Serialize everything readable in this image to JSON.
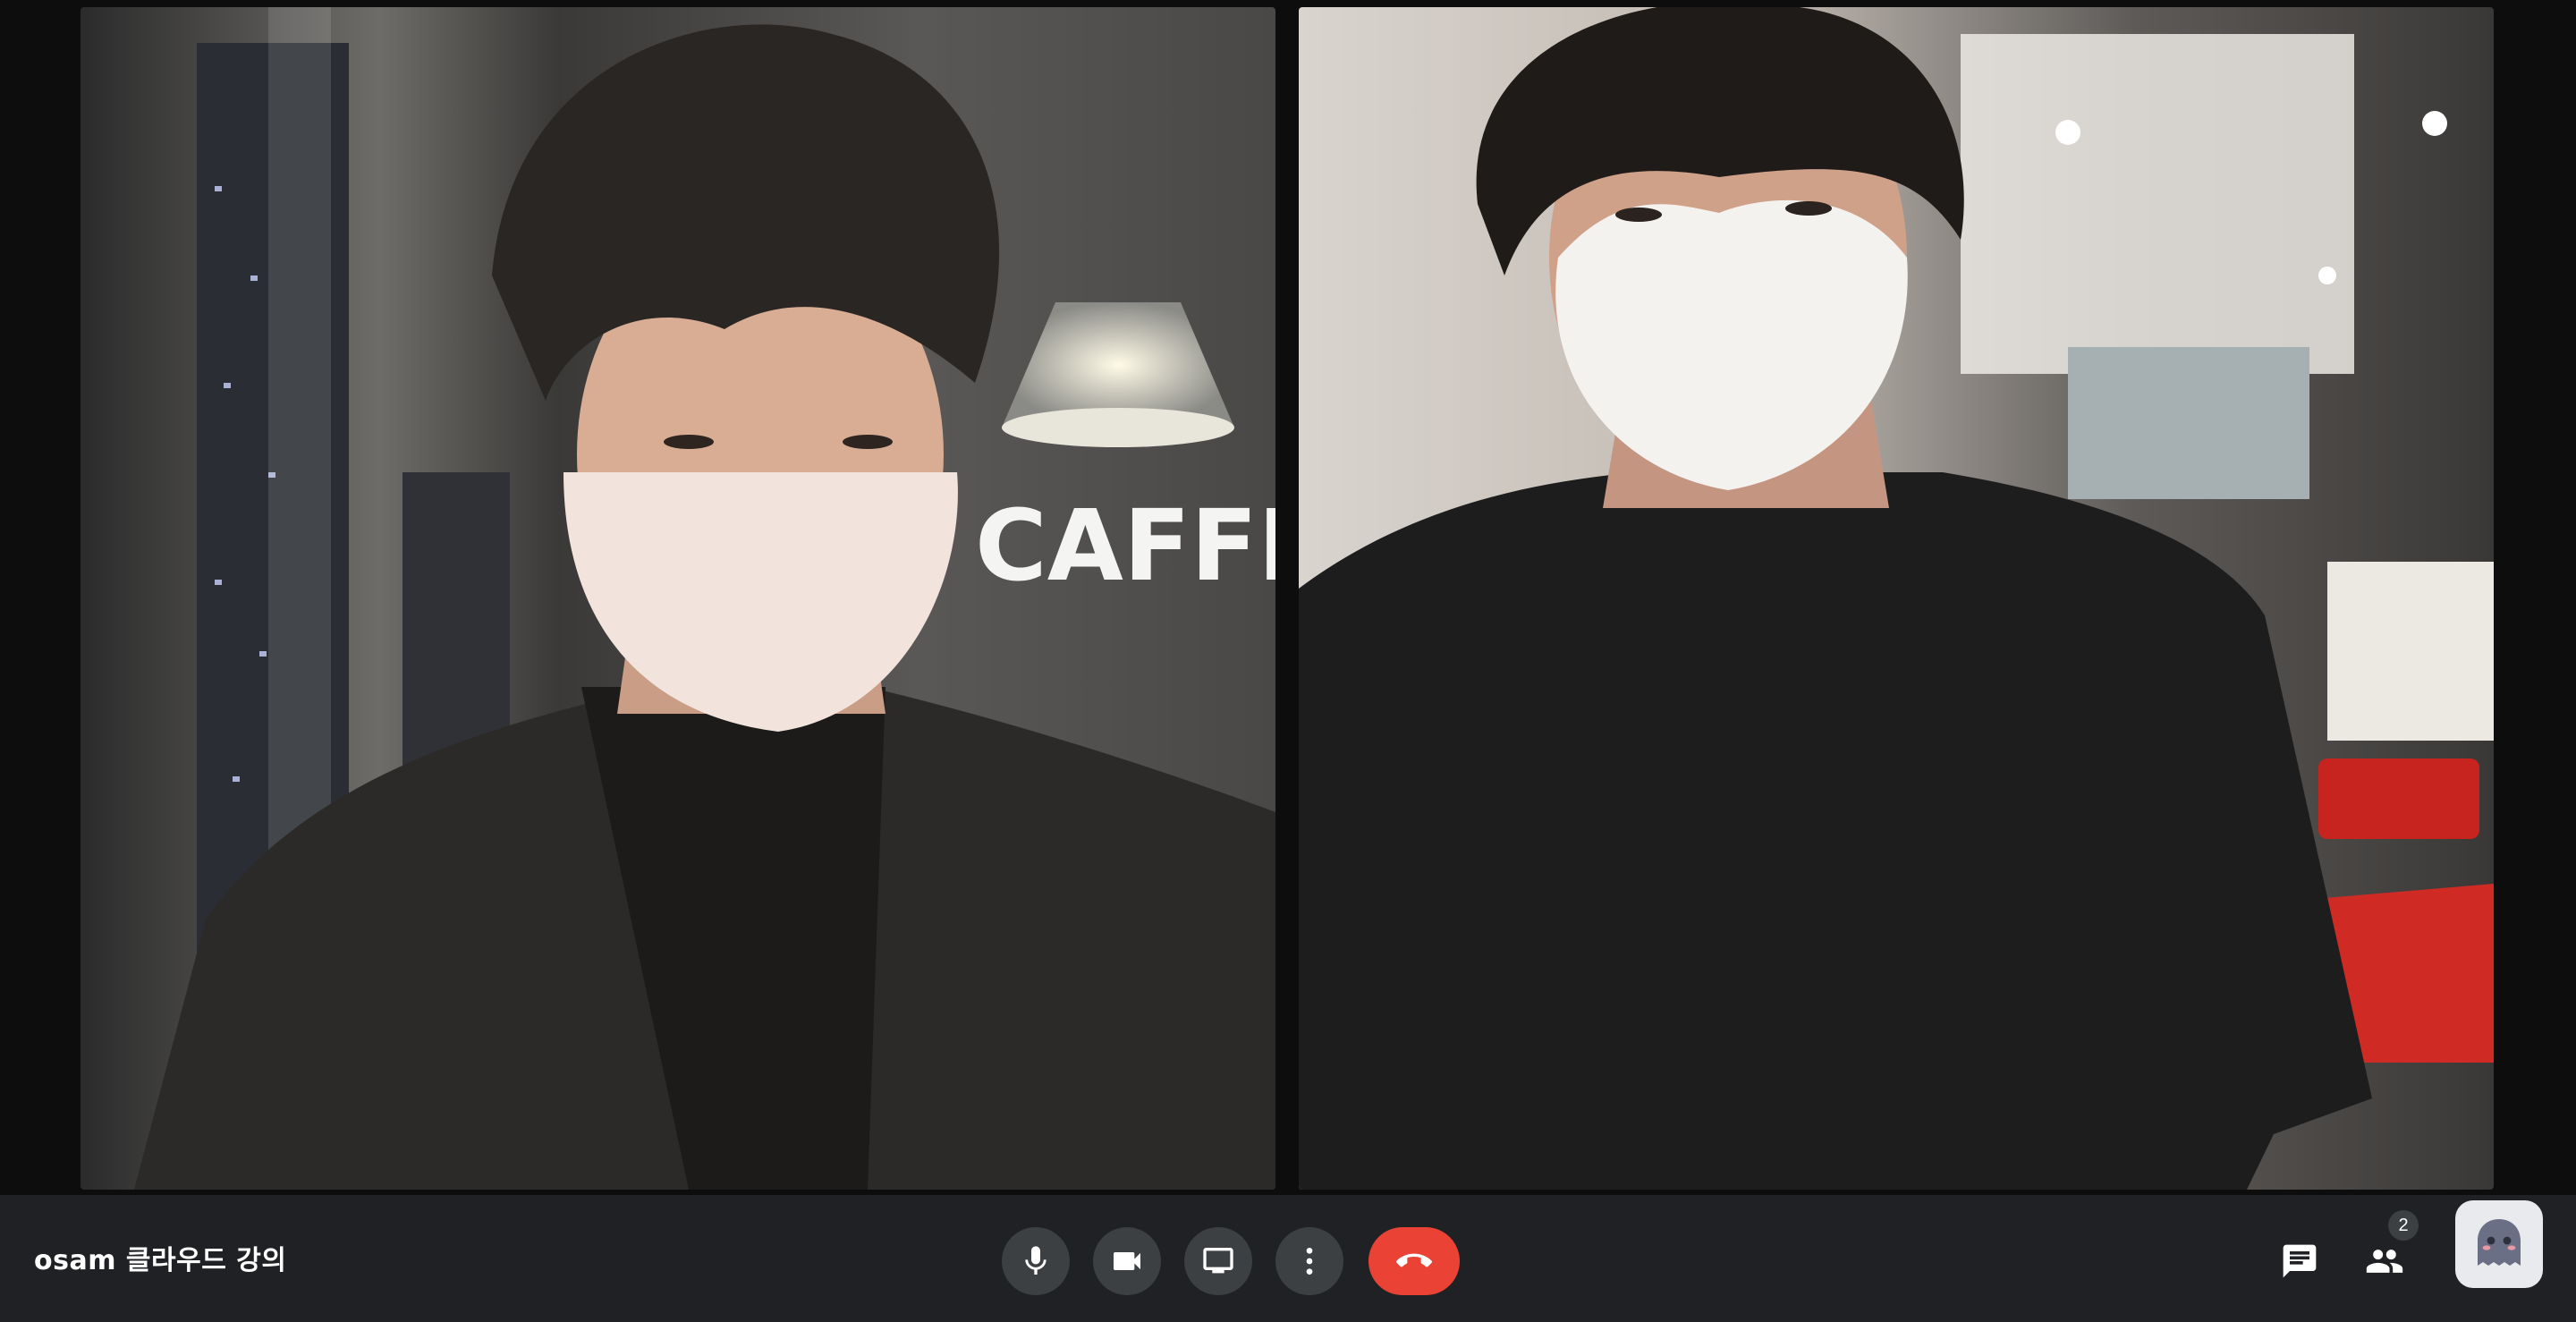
{
  "meeting": {
    "name": "osam 클라우드 강의"
  },
  "participants": {
    "count": "2",
    "tiles": [
      {
        "id": "participant-1"
      },
      {
        "id": "participant-2"
      }
    ]
  },
  "left_video": {
    "sign_text": "CAFFE"
  },
  "controls": {
    "icons": [
      "microphone-icon",
      "camera-icon",
      "present-screen-icon",
      "more-options-icon",
      "hang-up-icon"
    ]
  },
  "side_controls": {
    "icons": [
      "chat-icon",
      "people-icon",
      "assistant-avatar-icon"
    ]
  },
  "colors": {
    "bar_background": "#202124",
    "control_button": "#3c4043",
    "hang_up": "#ea4335",
    "icon": "#ffffff"
  }
}
